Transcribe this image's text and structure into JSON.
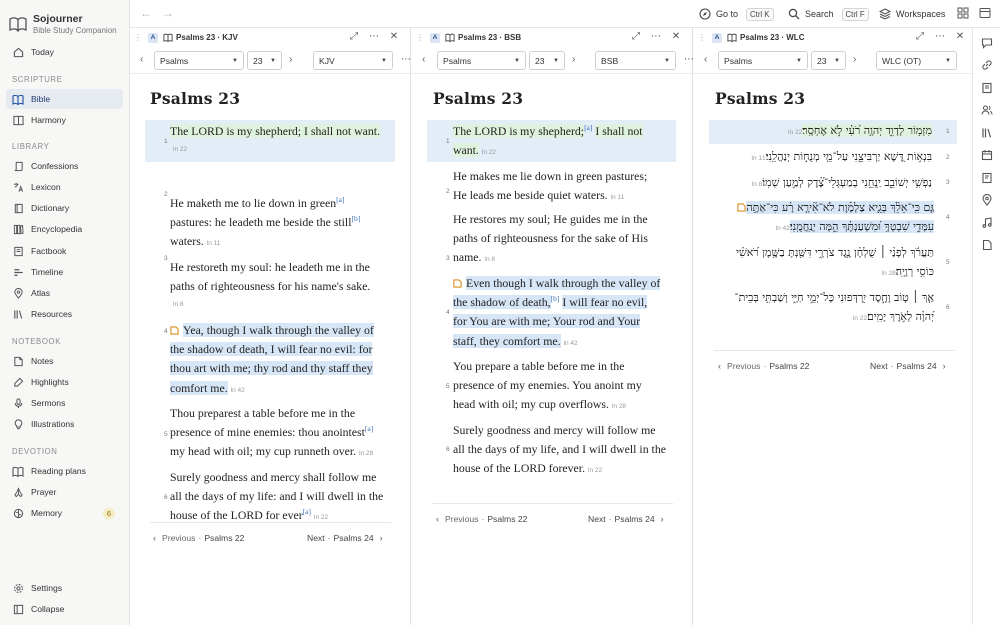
{
  "app": {
    "name": "Sojourner",
    "subtitle": "Bible Study Companion"
  },
  "sidebar": {
    "today": "Today",
    "sections": {
      "scripture": "SCRIPTURE",
      "library": "LIBRARY",
      "notebook": "NOTEBOOK",
      "devotion": "DEVOTION"
    },
    "scripture_items": [
      "Bible",
      "Harmony"
    ],
    "library_items": [
      "Confessions",
      "Lexicon",
      "Dictionary",
      "Encyclopedia",
      "Factbook",
      "Timeline",
      "Atlas",
      "Resources"
    ],
    "notebook_items": [
      "Notes",
      "Highlights",
      "Sermons",
      "Illustrations"
    ],
    "devotion_items": [
      "Reading plans",
      "Prayer",
      "Memory"
    ],
    "memory_badge": "6",
    "settings": "Settings",
    "collapse": "Collapse"
  },
  "topbar": {
    "goto_label": "Go to",
    "goto_kbd": "Ctrl K",
    "search_label": "Search",
    "search_kbd": "Ctrl F",
    "workspaces_label": "Workspaces"
  },
  "panes": [
    {
      "tab": "Psalms 23 · KJV",
      "book": "Psalms",
      "chapter": "23",
      "version": "KJV",
      "heading": "Psalms 23",
      "verses": [
        {
          "n": "1",
          "lines": [
            "The LORD is my shepherd; I shall not want."
          ],
          "ln": "ln 22"
        },
        {
          "n": "2",
          "lines": [
            "He maketh me to lie down in green",
            "pastures: he leadeth me beside the still",
            "waters."
          ],
          "sup_a": "[a]",
          "sup_b": "[b]",
          "ln": "ln 11"
        },
        {
          "n": "3",
          "lines": [
            "He restoreth my soul: he leadeth me in the",
            "paths of righteousness for his name's sake."
          ],
          "ln": "ln 8"
        },
        {
          "n": "4",
          "lines": [
            "Yea, though I walk through the valley of",
            "the shadow of death, I will fear no evil: for",
            "thou art with me; thy rod and thy staff they",
            "comfort me."
          ],
          "ln": "ln 42"
        },
        {
          "n": "5",
          "lines": [
            "Thou preparest a table before me in the",
            "presence of mine enemies: thou anointest",
            "my head with oil; my cup runneth over."
          ],
          "sup_a": "[a]",
          "ln": "ln 28"
        },
        {
          "n": "6",
          "lines": [
            "Surely goodness and mercy shall follow me",
            "all the days of my life: and I will dwell in the",
            "house of the LORD for ever"
          ],
          "sup_a": "[a]",
          "ln": "ln 22"
        }
      ],
      "prev": "Previous",
      "prev_ref": "Psalms 22",
      "next": "Next",
      "next_ref": "Psalms 24"
    },
    {
      "tab": "Psalms 23 · BSB",
      "book": "Psalms",
      "chapter": "23",
      "version": "BSB",
      "heading": "Psalms 23",
      "verses": [
        {
          "n": "1",
          "lines": [
            "The LORD is my shepherd;",
            "I shall not",
            "want."
          ],
          "sup_a": "[a]",
          "ln": "ln 22"
        },
        {
          "n": "2",
          "lines": [
            "He makes me lie down in green pastures;",
            "He leads me beside quiet waters."
          ],
          "ln": "ln 11"
        },
        {
          "n": "3",
          "lines": [
            "He restores my soul; He guides me in the",
            "paths of righteousness for the sake of His",
            "name."
          ],
          "ln": "ln 8"
        },
        {
          "n": "4",
          "lines": [
            "Even though I walk through the valley of",
            "the shadow of death,",
            "I will fear no evil,",
            "for You are with me; Your rod and Your",
            "staff, they comfort me."
          ],
          "sup_a": "[b]",
          "ln": "ln 42"
        },
        {
          "n": "5",
          "lines": [
            "You prepare a table before me in the",
            "presence of my enemies. You anoint my",
            "head with oil; my cup overflows."
          ],
          "ln": "ln 28"
        },
        {
          "n": "6",
          "lines": [
            "Surely goodness and mercy will follow me",
            "all the days of my life, and I will dwell in the",
            "house of the LORD forever."
          ],
          "ln": "ln 22"
        }
      ],
      "prev": "Previous",
      "prev_ref": "Psalms 22",
      "next": "Next",
      "next_ref": "Psalms 24"
    },
    {
      "tab": "Psalms 23 · WLC",
      "book": "Psalms",
      "chapter": "23",
      "version": "WLC (OT)",
      "heading": "Psalms 23",
      "verses": [
        {
          "n": "1",
          "lines": [
            "מִזְמ֥וֹר לְדָוִ֑ד יְהוָ֥ה רֹ֝עִ֗י לֹ֣א אֶחְסָֽר׃"
          ],
          "ln": "22 ln"
        },
        {
          "n": "2",
          "lines": [
            "בִּנְא֣וֹת דֶּ֭שֶׁא יַרְבִּיצֵ֑נִי עַל־מֵ֖י מְנֻח֣וֹת יְנַהֲלֵֽנִי׃"
          ],
          "ln": "11 ln"
        },
        {
          "n": "3",
          "lines": [
            "נַפְשִׁ֥י יְשׁוֹבֵ֑ב יַֽנְחֵ֥נִי בְמַעְגְּלֵי־צֶ֝֗דֶק לְמַ֣עַן שְׁמֽוֹ׃"
          ],
          "ln": "8 ln"
        },
        {
          "n": "4",
          "lines": [
            "גַּ֤ם כִּֽי־אֵלֵ֨ךְ בְּגֵ֪יא צַלְמָ֡וֶת לֹא־אִ֘ירָ֤א רָ֗ע כִּי־אַתָּ֥ה",
            "עִמָּדִ֑י שִׁבְטְךָ֥ וּ֝מִשְׁעַנְתֶּ֗ךָ הֵ֣מָּה יְנַֽחֲמֻֽנִי׃"
          ],
          "ln": "42 ln"
        },
        {
          "n": "5",
          "lines": [
            "תַּעֲרֹ֬ךְ לְפָנַ֨י ׀ שֻׁלְחָ֗ן נֶ֥גֶד צֹרְרָ֑י דִּשַּׁ֖נְתָּ בַשֶּׁ֥מֶן רֹ֝אשִׁ֗י",
            "כּוֹסִ֥י רְוָיָֽה׃"
          ],
          "ln": "28 ln"
        },
        {
          "n": "6",
          "lines": [
            "אַ֤ךְ ׀ ט֤וֹב וָחֶ֣סֶד יִ֭רְדְּפוּנִי כָּל־יְמֵ֣י חַיָּ֑י וְשַׁבְתִּ֥י בְּבֵית־",
            "יְ֝הוָ֗ה לְאֹ֣רֶךְ יָמִֽים׃"
          ],
          "ln": "22 ln"
        }
      ],
      "prev": "Previous",
      "prev_ref": "Psalms 22",
      "next": "Next",
      "next_ref": "Psalms 24"
    }
  ],
  "colors": {
    "accent": "#1f4fa0",
    "verse_green": "#dff2dd",
    "verse_blue": "#d7e6f7",
    "note_orange": "#d98e1f"
  }
}
